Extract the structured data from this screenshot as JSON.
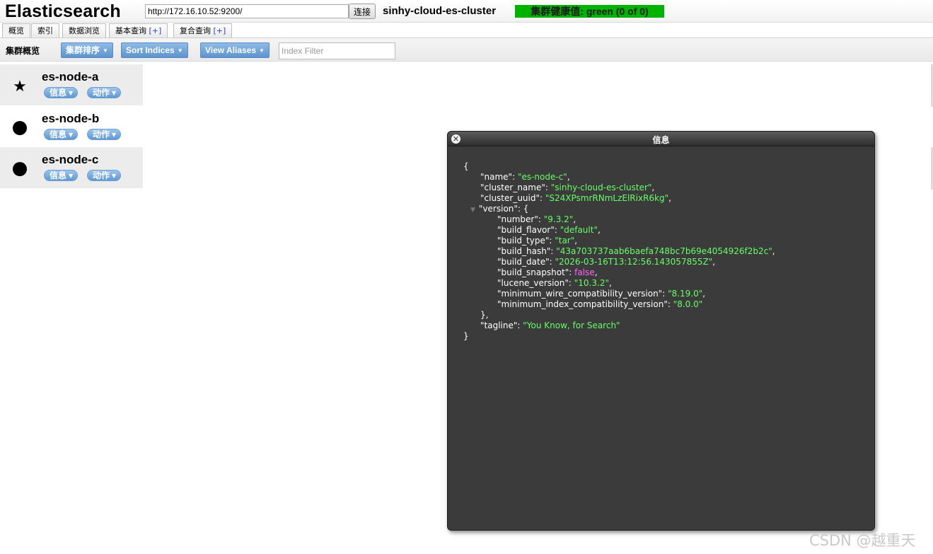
{
  "header": {
    "app_title": "Elasticsearch",
    "url_value": "http://172.16.10.52:9200/",
    "connect_label": "连接",
    "cluster_name": "sinhy-cloud-es-cluster",
    "health_label": "集群健康值: green (0 of 0)",
    "health_color": "#00b300"
  },
  "tabs": [
    {
      "label": "概览",
      "plus": ""
    },
    {
      "label": "索引",
      "plus": ""
    },
    {
      "label": "数据浏览",
      "plus": ""
    },
    {
      "label": "基本查询",
      "plus": "[+]"
    },
    {
      "label": "复合查询",
      "plus": "[+]"
    }
  ],
  "toolbar": {
    "title": "集群概览",
    "sort_cluster_label": "集群排序",
    "sort_indices_label": "Sort Indices",
    "view_aliases_label": "View Aliases",
    "index_filter_placeholder": "Index Filter"
  },
  "nodes": [
    {
      "name": "es-node-a",
      "icon": "star-icon",
      "info_label": "信息",
      "action_label": "动作"
    },
    {
      "name": "es-node-b",
      "icon": "dot-icon",
      "info_label": "信息",
      "action_label": "动作"
    },
    {
      "name": "es-node-c",
      "icon": "dot-icon",
      "info_label": "信息",
      "action_label": "动作"
    }
  ],
  "dialog": {
    "title": "信息",
    "json": {
      "open": "{",
      "name_key": "\"name\"",
      "name_val": "\"es-node-c\"",
      "cluster_name_key": "\"cluster_name\"",
      "cluster_name_val": "\"sinhy-cloud-es-cluster\"",
      "cluster_uuid_key": "\"cluster_uuid\"",
      "cluster_uuid_val": "\"S24XPsmrRNmLzElRixR6kg\"",
      "version_key": "\"version\"",
      "number_key": "\"number\"",
      "number_val": "\"9.3.2\"",
      "build_flavor_key": "\"build_flavor\"",
      "build_flavor_val": "\"default\"",
      "build_type_key": "\"build_type\"",
      "build_type_val": "\"tar\"",
      "build_hash_key": "\"build_hash\"",
      "build_hash_val": "\"43a703737aab6baefa748bc7b69e4054926f2b2c\"",
      "build_date_key": "\"build_date\"",
      "build_date_val": "\"2026-03-16T13:12:56.143057855Z\"",
      "build_snapshot_key": "\"build_snapshot\"",
      "build_snapshot_val": "false",
      "lucene_version_key": "\"lucene_version\"",
      "lucene_version_val": "\"10.3.2\"",
      "min_wire_key": "\"minimum_wire_compatibility_version\"",
      "min_wire_val": "\"8.19.0\"",
      "min_index_key": "\"minimum_index_compatibility_version\"",
      "min_index_val": "\"8.0.0\"",
      "tagline_key": "\"tagline\"",
      "tagline_val": "\"You Know, for Search\"",
      "close": "}"
    }
  },
  "watermark": "CSDN @越重天"
}
